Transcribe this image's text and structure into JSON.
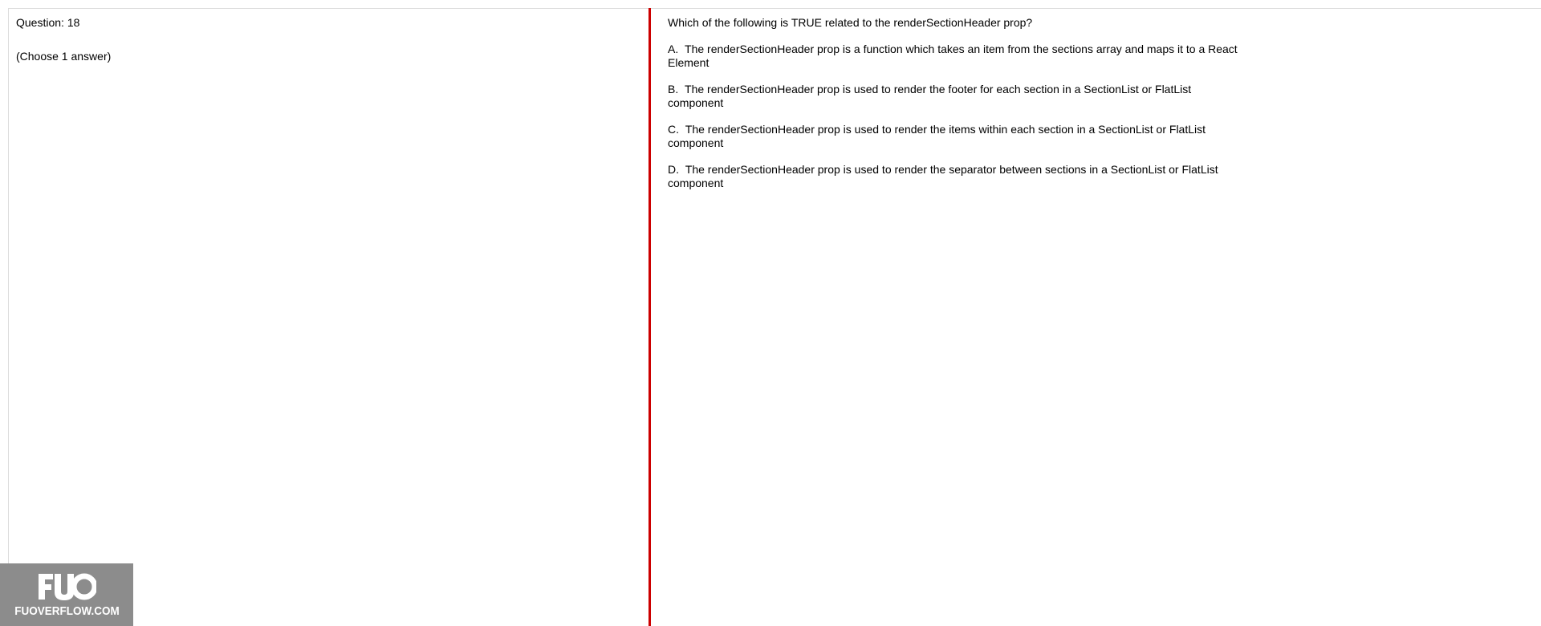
{
  "question": {
    "number_label": "Question: 18",
    "answer_hint": "(Choose 1 answer)",
    "text": "Which of the following is TRUE related to the renderSectionHeader prop?",
    "options": [
      {
        "letter": "A.",
        "text": "The renderSectionHeader prop is a function which takes an item from the sections array and maps it to a React Element"
      },
      {
        "letter": "B.",
        "text": "The renderSectionHeader prop is used to render the footer for each section in a SectionList or FlatList component"
      },
      {
        "letter": "C.",
        "text": "The renderSectionHeader prop is used to render the items within each section in a SectionList or FlatList component"
      },
      {
        "letter": "D.",
        "text": "The renderSectionHeader prop is used to render the separator between sections in a SectionList or FlatList component"
      }
    ]
  },
  "watermark": {
    "logo": "FUO",
    "site": "FUOVERFLOW.COM"
  },
  "colors": {
    "divider": "#cc0000",
    "watermark_bg": "#8c8c8c",
    "border": "#dcdcdc"
  }
}
